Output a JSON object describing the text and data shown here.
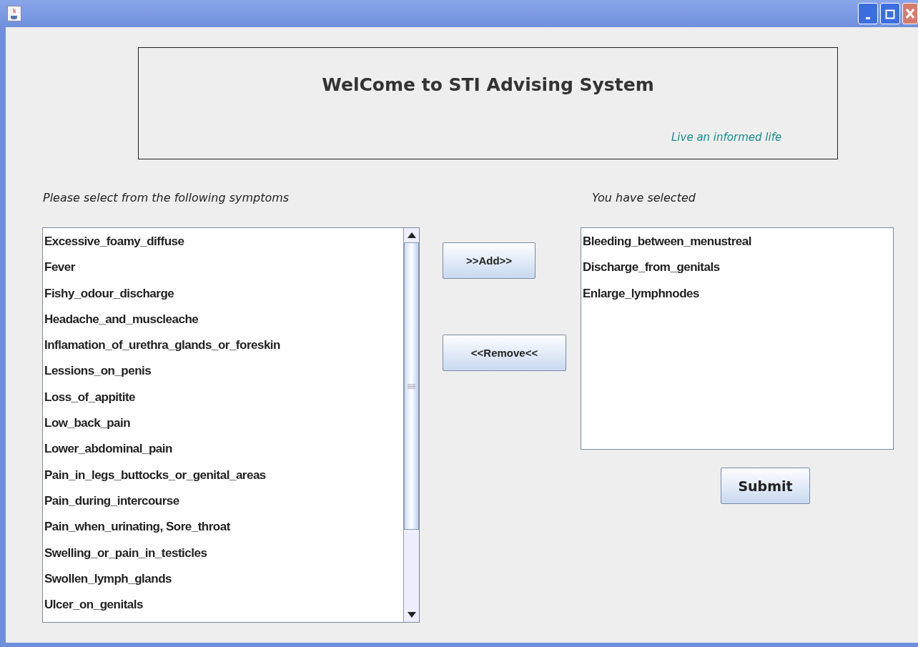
{
  "banner": {
    "title": "WelCome to STI Advising System",
    "tagline": "Live an informed life"
  },
  "available": {
    "label": "Please select from the following symptoms",
    "items": [
      "Excessive_foamy_diffuse",
      "Fever",
      "Fishy_odour_discharge",
      "Headache_and_muscleache",
      "Inflamation_of_urethra_glands_or_foreskin",
      "Lessions_on_penis",
      "Loss_of_appitite",
      "Low_back_pain",
      "Lower_abdominal_pain",
      "Pain_in_legs_buttocks_or_genital_areas",
      "Pain_during_intercourse",
      "Pain_when_urinating, Sore_throat",
      "Swelling_or_pain_in_testicles",
      "Swollen_lymph_glands",
      "Ulcer_on_genitals"
    ]
  },
  "add_button": ">>Add>>",
  "remove_button": "<<Remove<<",
  "chosen": {
    "label": "You have selected",
    "items": [
      "Bleeding_between_menustreal",
      "Discharge_from_genitals",
      "Enlarge_lymphnodes"
    ]
  },
  "submit_button": "Submit"
}
